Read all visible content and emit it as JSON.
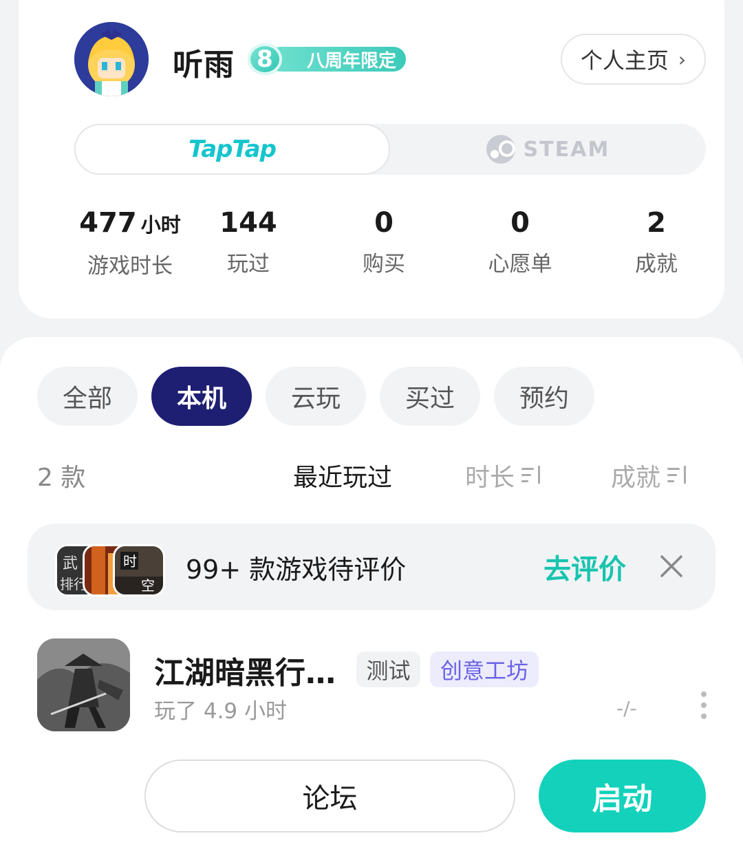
{
  "profile": {
    "username": "听雨",
    "badge_number": "8",
    "badge_text": "八周年限定",
    "homepage_label": "个人主页",
    "platforms": [
      {
        "label": "TapTap",
        "active": true
      },
      {
        "label": "STEAM",
        "active": false
      }
    ],
    "stats": [
      {
        "value": "477",
        "unit": "小时",
        "label": "游戏时长"
      },
      {
        "value": "144",
        "unit": "",
        "label": "玩过"
      },
      {
        "value": "0",
        "unit": "",
        "label": "购买"
      },
      {
        "value": "0",
        "unit": "",
        "label": "心愿单"
      },
      {
        "value": "2",
        "unit": "",
        "label": "成就"
      }
    ]
  },
  "filters": {
    "chips": [
      "全部",
      "本机",
      "云玩",
      "买过",
      "预约"
    ],
    "active": "本机"
  },
  "sort": {
    "count": "2 款",
    "options": [
      "最近玩过",
      "时长",
      "成就"
    ],
    "active": "最近玩过"
  },
  "review_banner": {
    "text": "99+ 款游戏待评价",
    "action": "去评价",
    "thumb_texts": [
      "武",
      "排行",
      "时",
      "空"
    ]
  },
  "game": {
    "title": "江湖暗黑行…",
    "tags": [
      "测试",
      "创意工坊"
    ],
    "playtime": "玩了 4.9 小时",
    "score": "-/-",
    "forum_label": "论坛",
    "launch_label": "启动"
  },
  "colors": {
    "accent": "#13d1bb",
    "active_chip": "#1e1f72",
    "taptap": "#15c5ce",
    "workshop_tag": "#6a62e6"
  }
}
